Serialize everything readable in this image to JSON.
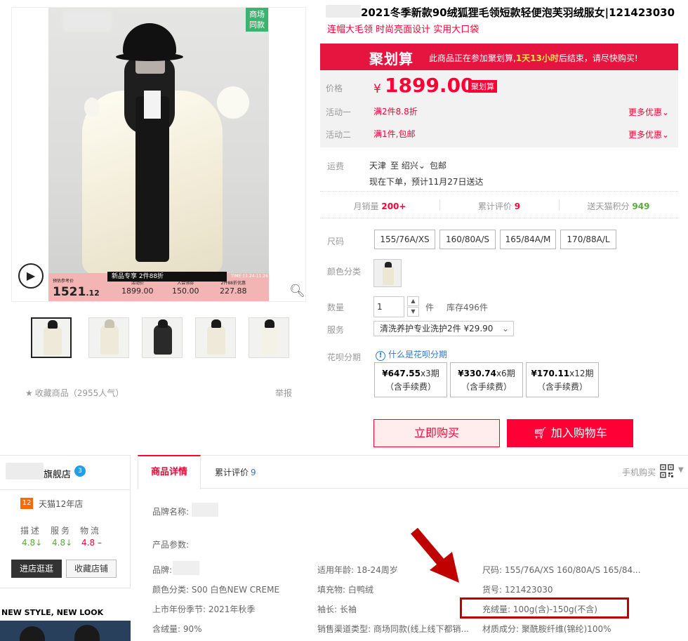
{
  "gallery": {
    "badge": [
      "商场",
      "同款"
    ],
    "promo_title": "新品专享 2件88折",
    "promo_time": "TIME:11.24-11.26",
    "price_ref_label": "预估参考价",
    "price_ref": "1521",
    "price_ref_dec": ".12",
    "cols": [
      {
        "label": "活动价",
        "value": "1899.00"
      },
      {
        "label": "入会领券",
        "value": "150.00"
      },
      {
        "label": "2件88折优惠",
        "value": "227.88"
      }
    ]
  },
  "favorite": {
    "label": "收藏商品",
    "count": "（2955人气）"
  },
  "report_label": "举报",
  "product": {
    "title": "2021冬季新款90绒狐狸毛领短款轻便泡芙羽绒服女|121423030",
    "subtitle": "连帽大毛领 时尚亮面设计 实用大口袋"
  },
  "juhuasuan": {
    "logo": "聚划算",
    "msg_prefix": "此商品正在参加聚划算,",
    "msg_highlight": "1天13小时",
    "msg_suffix": "后结束，请尽快购买!"
  },
  "price": {
    "label": "价格",
    "symbol": "¥",
    "value": "1899.00",
    "tag": "聚划算"
  },
  "activities": [
    {
      "label": "活动一",
      "text": "满2件8.8折",
      "more": "更多优惠"
    },
    {
      "label": "活动二",
      "text": "满1件,包邮",
      "more": "更多优惠"
    }
  ],
  "shipping": {
    "label": "运费",
    "from": "天津",
    "to": "至 绍兴",
    "free": "包邮",
    "delivery": "现在下单，预计11月27日送达"
  },
  "stats": [
    {
      "label": "月销量",
      "value": "200+"
    },
    {
      "label": "累计评价",
      "value": "9"
    },
    {
      "label": "送天猫积分",
      "value": "949"
    }
  ],
  "size": {
    "label": "尺码",
    "options": [
      "155/76A/XS",
      "160/80A/S",
      "165/84A/M",
      "170/88A/L"
    ]
  },
  "color_label": "颜色分类",
  "quantity": {
    "label": "数量",
    "value": "1",
    "unit": "件",
    "stock": "库存496件"
  },
  "service": {
    "label": "服务",
    "value": "清洗养护专业洗护2件 ¥29.90"
  },
  "huabei": {
    "label": "花呗分期",
    "info": "什么是花呗分期",
    "plans": [
      {
        "amount": "¥647.55",
        "periods": "x3期",
        "fee": "（含手续费）"
      },
      {
        "amount": "¥330.74",
        "periods": "x6期",
        "fee": "（含手续费）"
      },
      {
        "amount": "¥170.11",
        "periods": "x12期",
        "fee": "（含手续费）"
      }
    ]
  },
  "actions": {
    "buy_now": "立即购买",
    "add_cart": "加入购物车"
  },
  "shop": {
    "name": "旗舰店",
    "level": "3",
    "years_badge": "12",
    "years": "天猫12年店",
    "dsr": [
      {
        "label": "描述",
        "value": "4.8",
        "trend": "↓"
      },
      {
        "label": "服务",
        "value": "4.8",
        "trend": "↓"
      },
      {
        "label": "物流",
        "value": "4.8",
        "trend": "–"
      }
    ],
    "enter": "进店逛逛",
    "favorite": "收藏店铺",
    "ad_tag": "NEW STYLE, NEW LOOK"
  },
  "tabs": {
    "detail": "商品详情",
    "reviews": "累计评价",
    "reviews_count": "9",
    "mobile": "手机购买"
  },
  "attributes": {
    "brand_label": "品牌名称:",
    "params_title": "产品参数:",
    "brand": "品牌:",
    "age": "适用年龄: 18-24周岁",
    "size": "尺码: 155/76A/XS 160/80A/S 165/84...",
    "color": "颜色分类: S00 白色NEW CREME",
    "filling": "填充物: 白鸭绒",
    "item_no": "货号: 121423030",
    "season": "上市年份季节: 2021年秋季",
    "sleeve": "袖长: 长袖",
    "fill_amount": "充绒量: 100g(含)-150g(不含)",
    "down_content": "含绒量: 90%",
    "channel": "销售渠道类型: 商场同款(线上线下都销...",
    "material": "材质成分: 聚酰胺纤维(锦纶)100%"
  },
  "colors": {
    "accent": "#ff0036",
    "juhuasuan": "#e5153f",
    "green": "#5aab3c",
    "annotation": "#c00000"
  }
}
